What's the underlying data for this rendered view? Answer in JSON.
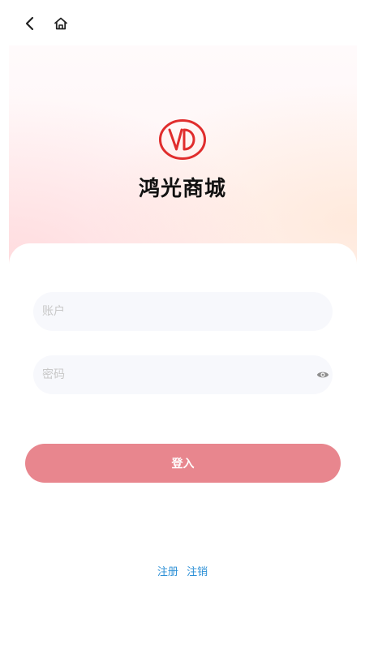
{
  "app": {
    "title": "鸿光商城"
  },
  "nav": {
    "back_icon": "chevron-left-icon",
    "home_icon": "home-icon"
  },
  "login_form": {
    "account_placeholder": "账户",
    "account_value": "",
    "password_placeholder": "密码",
    "password_value": "",
    "password_toggle_icon": "eye-icon",
    "submit_label": "登入"
  },
  "footer_links": {
    "register_label": "注册",
    "deregister_label": "注销"
  },
  "colors": {
    "brand_red": "#e02d2d",
    "button": "#e8868e",
    "link": "#2b8fd6",
    "field_bg": "#f7f8fc"
  }
}
